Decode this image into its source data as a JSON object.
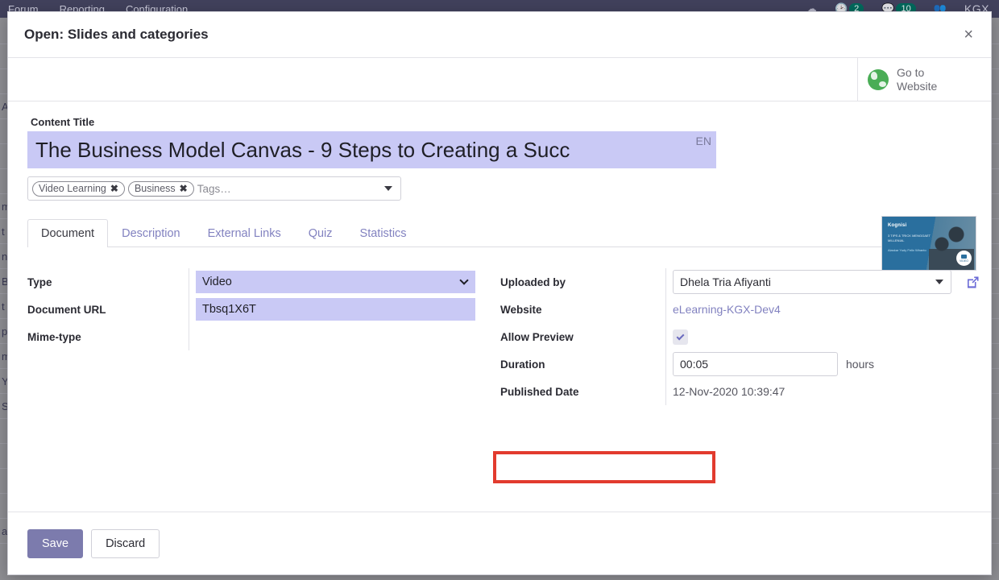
{
  "navbar": {
    "menu_items": [
      "Forum",
      "Reporting",
      "Configuration"
    ],
    "activity_badge": "2",
    "messages_badge": "10",
    "user_label": "KGX"
  },
  "background_rows": [
    "",
    "",
    "",
    "A",
    "",
    "",
    "",
    "m",
    "t",
    "n",
    "B",
    "t",
    "p",
    "m",
    "Y",
    "S",
    "",
    "",
    "",
    "",
    "ag"
  ],
  "modal": {
    "title": "Open: Slides and categories",
    "close_label": "×",
    "goto_website_label": "Go to\nWebsite",
    "globe_icon": "globe-icon"
  },
  "content": {
    "title_label": "Content Title",
    "title_value": "The Business Model Canvas - 9 Steps to Creating a Succ",
    "language_badge": "EN",
    "tags": [
      {
        "label": "Video Learning",
        "remove_glyph": "✖"
      },
      {
        "label": "Business",
        "remove_glyph": "✖"
      }
    ],
    "tags_placeholder": "Tags…"
  },
  "tabs": [
    {
      "label": "Document",
      "active": true
    },
    {
      "label": "Description",
      "active": false
    },
    {
      "label": "External Links",
      "active": false
    },
    {
      "label": "Quiz",
      "active": false
    },
    {
      "label": "Statistics",
      "active": false
    }
  ],
  "form": {
    "left": {
      "type_label": "Type",
      "type_value": "Video",
      "document_url_label": "Document URL",
      "document_url_value": "Tbsq1X6T",
      "mime_type_label": "Mime-type",
      "mime_type_value": ""
    },
    "right": {
      "uploaded_by_label": "Uploaded by",
      "uploaded_by_value": "Dhela Tria Afiyanti",
      "website_label": "Website",
      "website_value": "eLearning-KGX-Dev4",
      "allow_preview_label": "Allow Preview",
      "allow_preview_checked": true,
      "duration_label": "Duration",
      "duration_value": "00:05",
      "duration_suffix": "hours",
      "published_date_label": "Published Date",
      "published_date_value": "12-Nov-2020 10:39:47"
    }
  },
  "thumbnail": {
    "brand": "Kognisi",
    "headline": "3 TIPS & TRICK\nMENGGAET MILLENIAL",
    "names": "Alaskar Yudy\nFelix Wiranto",
    "badge": "VIDEO"
  },
  "footer": {
    "save_label": "Save",
    "discard_label": "Discard"
  },
  "colors": {
    "accent": "#7c7bad",
    "focus_field": "#c9c9f5",
    "link": "#8282c0",
    "highlight": "#e23b2e",
    "navbar": "#41415c"
  }
}
